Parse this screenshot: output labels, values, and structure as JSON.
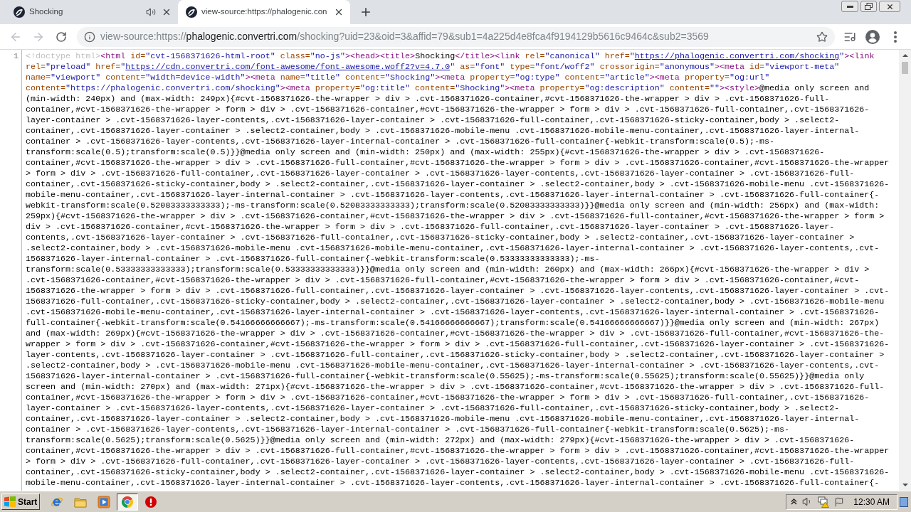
{
  "tabs": [
    {
      "title": "Shocking",
      "selected": false,
      "audio": true
    },
    {
      "title": "view-source:https://phalogenic.con",
      "selected": true,
      "audio": false
    }
  ],
  "toolbar": {
    "back": {
      "disabled": true
    },
    "forward": {
      "disabled": true
    }
  },
  "address_bar": {
    "url_parts": [
      {
        "text": "view-source:https://",
        "emphasis": false
      },
      {
        "text": "phalogenic.convertri.com",
        "emphasis": true
      },
      {
        "text": "/shocking?uid=23&oid=3&affid=79&sub1=4a225d4e8fca4f9194129b5616c9464c&sub2=3569",
        "emphasis": false
      }
    ]
  },
  "source": {
    "line_number": "1",
    "rows": [
      {
        "segments": [
          {
            "kind": "doctype",
            "text": "<!doctype html>"
          },
          {
            "kind": "tag",
            "text": "<html"
          },
          {
            "kind": "attr",
            "text": " id="
          },
          {
            "kind": "value",
            "text": "\"cvt-1568371626-html-root\""
          },
          {
            "kind": "attr",
            "text": " class="
          },
          {
            "kind": "value",
            "text": "\"no-js\""
          },
          {
            "kind": "tag",
            "text": "><head><title>"
          },
          {
            "kind": "text",
            "text": "Shocking"
          },
          {
            "kind": "tag",
            "text": "</title><link"
          },
          {
            "kind": "attr",
            "text": " rel="
          },
          {
            "kind": "value",
            "text": "\"canonical\""
          },
          {
            "kind": "attr",
            "text": " href="
          },
          {
            "kind": "value",
            "text": "\""
          },
          {
            "kind": "link",
            "text": "https://phalogenic.convertri.com/shocking"
          },
          {
            "kind": "value",
            "text": "\""
          },
          {
            "kind": "tag",
            "text": "><link"
          }
        ]
      },
      {
        "segments": [
          {
            "kind": "attr",
            "text": "rel="
          },
          {
            "kind": "value",
            "text": "\"preload\""
          },
          {
            "kind": "attr",
            "text": " href="
          },
          {
            "kind": "value",
            "text": "\""
          },
          {
            "kind": "link",
            "text": "https://cdn.convertri.com/font-awesome/font-awesome.woff2?v=4.7.0"
          },
          {
            "kind": "value",
            "text": "\""
          },
          {
            "kind": "attr",
            "text": " as="
          },
          {
            "kind": "value",
            "text": "\"font\""
          },
          {
            "kind": "attr",
            "text": " type="
          },
          {
            "kind": "value",
            "text": "\"font/woff2\""
          },
          {
            "kind": "attr",
            "text": " crossorigin="
          },
          {
            "kind": "value",
            "text": "\"anonymous\""
          },
          {
            "kind": "tag",
            "text": "><meta"
          },
          {
            "kind": "attr",
            "text": " id="
          },
          {
            "kind": "value",
            "text": "\"viewport-meta\""
          }
        ]
      },
      {
        "segments": [
          {
            "kind": "attr",
            "text": "name="
          },
          {
            "kind": "value",
            "text": "\"viewport\""
          },
          {
            "kind": "attr",
            "text": " content="
          },
          {
            "kind": "value",
            "text": "\"width=device-width\""
          },
          {
            "kind": "tag",
            "text": "><meta"
          },
          {
            "kind": "attr",
            "text": " name="
          },
          {
            "kind": "value",
            "text": "\"title\""
          },
          {
            "kind": "attr",
            "text": " content="
          },
          {
            "kind": "value",
            "text": "\"Shocking\""
          },
          {
            "kind": "tag",
            "text": "><meta"
          },
          {
            "kind": "attr",
            "text": " property="
          },
          {
            "kind": "value",
            "text": "\"og:type\""
          },
          {
            "kind": "attr",
            "text": " content="
          },
          {
            "kind": "value",
            "text": "\"article\""
          },
          {
            "kind": "tag",
            "text": "><meta"
          },
          {
            "kind": "attr",
            "text": " property="
          },
          {
            "kind": "value",
            "text": "\"og:url\""
          }
        ]
      },
      {
        "segments": [
          {
            "kind": "attr",
            "text": "content="
          },
          {
            "kind": "value",
            "text": "\"https://phalogenic.convertri.com/shocking\""
          },
          {
            "kind": "tag",
            "text": "><meta"
          },
          {
            "kind": "attr",
            "text": " property="
          },
          {
            "kind": "value",
            "text": "\"og:title\""
          },
          {
            "kind": "attr",
            "text": " content="
          },
          {
            "kind": "value",
            "text": "\"Shocking\""
          },
          {
            "kind": "tag",
            "text": "><meta"
          },
          {
            "kind": "attr",
            "text": " property="
          },
          {
            "kind": "value",
            "text": "\"og:description\""
          },
          {
            "kind": "attr",
            "text": " content="
          },
          {
            "kind": "value",
            "text": "\"\""
          },
          {
            "kind": "tag",
            "text": "><style>"
          },
          {
            "kind": "text",
            "text": "@media only screen and"
          }
        ]
      },
      {
        "segments": [
          {
            "kind": "text",
            "text": "(min-width: 240px) and (max-width: 249px){#cvt-1568371626-the-wrapper > div > .cvt-1568371626-container,#cvt-1568371626-the-wrapper > div > .cvt-1568371626-full-"
          }
        ]
      },
      {
        "segments": [
          {
            "kind": "text",
            "text": "container,#cvt-1568371626-the-wrapper > form > div > .cvt-1568371626-container,#cvt-1568371626-the-wrapper > form > div > .cvt-1568371626-full-container,.cvt-1568371626-"
          }
        ]
      },
      {
        "segments": [
          {
            "kind": "text",
            "text": "layer-container > .cvt-1568371626-layer-contents,.cvt-1568371626-layer-container > .cvt-1568371626-full-container,.cvt-1568371626-sticky-container,body > .select2-"
          }
        ]
      },
      {
        "segments": [
          {
            "kind": "text",
            "text": "container,.cvt-1568371626-layer-container > .select2-container,body > .cvt-1568371626-mobile-menu .cvt-1568371626-mobile-menu-container,.cvt-1568371626-layer-internal-"
          }
        ]
      },
      {
        "segments": [
          {
            "kind": "text",
            "text": "container > .cvt-1568371626-layer-contents,.cvt-1568371626-layer-internal-container > .cvt-1568371626-full-container{-webkit-transform:scale(0.5);-ms-"
          }
        ]
      },
      {
        "segments": [
          {
            "kind": "text",
            "text": "transform:scale(0.5);transform:scale(0.5)}}@media only screen and (min-width: 250px) and (max-width: 255px){#cvt-1568371626-the-wrapper > div > .cvt-1568371626-"
          }
        ]
      },
      {
        "segments": [
          {
            "kind": "text",
            "text": "container,#cvt-1568371626-the-wrapper > div > .cvt-1568371626-full-container,#cvt-1568371626-the-wrapper > form > div > .cvt-1568371626-container,#cvt-1568371626-the-wrapper"
          }
        ]
      },
      {
        "segments": [
          {
            "kind": "text",
            "text": "> form > div > .cvt-1568371626-full-container,.cvt-1568371626-layer-container > .cvt-1568371626-layer-contents,.cvt-1568371626-layer-container > .cvt-1568371626-full-"
          }
        ]
      },
      {
        "segments": [
          {
            "kind": "text",
            "text": "container,.cvt-1568371626-sticky-container,body > .select2-container,.cvt-1568371626-layer-container > .select2-container,body > .cvt-1568371626-mobile-menu .cvt-1568371626-"
          }
        ]
      },
      {
        "segments": [
          {
            "kind": "text",
            "text": "mobile-menu-container,.cvt-1568371626-layer-internal-container > .cvt-1568371626-layer-contents,.cvt-1568371626-layer-internal-container > .cvt-1568371626-full-container{-"
          }
        ]
      },
      {
        "segments": [
          {
            "kind": "text",
            "text": "webkit-transform:scale(0.52083333333333);-ms-transform:scale(0.52083333333333);transform:scale(0.52083333333333)}}@media only screen and (min-width: 256px) and (max-width:"
          }
        ]
      },
      {
        "segments": [
          {
            "kind": "text",
            "text": "259px){#cvt-1568371626-the-wrapper > div > .cvt-1568371626-container,#cvt-1568371626-the-wrapper > div > .cvt-1568371626-full-container,#cvt-1568371626-the-wrapper > form >"
          }
        ]
      },
      {
        "segments": [
          {
            "kind": "text",
            "text": "div > .cvt-1568371626-container,#cvt-1568371626-the-wrapper > form > div > .cvt-1568371626-full-container,.cvt-1568371626-layer-container > .cvt-1568371626-layer-"
          }
        ]
      },
      {
        "segments": [
          {
            "kind": "text",
            "text": "contents,.cvt-1568371626-layer-container > .cvt-1568371626-full-container,.cvt-1568371626-sticky-container,body > .select2-container,.cvt-1568371626-layer-container >"
          }
        ]
      },
      {
        "segments": [
          {
            "kind": "text",
            "text": ".select2-container,body > .cvt-1568371626-mobile-menu .cvt-1568371626-mobile-menu-container,.cvt-1568371626-layer-internal-container > .cvt-1568371626-layer-contents,.cvt-"
          }
        ]
      },
      {
        "segments": [
          {
            "kind": "text",
            "text": "1568371626-layer-internal-container > .cvt-1568371626-full-container{-webkit-transform:scale(0.53333333333333);-ms-"
          }
        ]
      },
      {
        "segments": [
          {
            "kind": "text",
            "text": "transform:scale(0.53333333333333);transform:scale(0.53333333333333)}}@media only screen and (min-width: 260px) and (max-width: 266px){#cvt-1568371626-the-wrapper > div >"
          }
        ]
      },
      {
        "segments": [
          {
            "kind": "text",
            "text": ".cvt-1568371626-container,#cvt-1568371626-the-wrapper > div > .cvt-1568371626-full-container,#cvt-1568371626-the-wrapper > form > div > .cvt-1568371626-container,#cvt-"
          }
        ]
      },
      {
        "segments": [
          {
            "kind": "text",
            "text": "1568371626-the-wrapper > form > div > .cvt-1568371626-full-container,.cvt-1568371626-layer-container > .cvt-1568371626-layer-contents,.cvt-1568371626-layer-container > .cvt-"
          }
        ]
      },
      {
        "segments": [
          {
            "kind": "text",
            "text": "1568371626-full-container,.cvt-1568371626-sticky-container,body > .select2-container,.cvt-1568371626-layer-container > .select2-container,body > .cvt-1568371626-mobile-menu"
          }
        ]
      },
      {
        "segments": [
          {
            "kind": "text",
            "text": ".cvt-1568371626-mobile-menu-container,.cvt-1568371626-layer-internal-container > .cvt-1568371626-layer-contents,.cvt-1568371626-layer-internal-container > .cvt-1568371626-"
          }
        ]
      },
      {
        "segments": [
          {
            "kind": "text",
            "text": "full-container{-webkit-transform:scale(0.54166666666667);-ms-transform:scale(0.54166666666667);transform:scale(0.54166666666667)}}@media only screen and (min-width: 267px)"
          }
        ]
      },
      {
        "segments": [
          {
            "kind": "text",
            "text": "and (max-width: 269px){#cvt-1568371626-the-wrapper > div > .cvt-1568371626-container,#cvt-1568371626-the-wrapper > div > .cvt-1568371626-full-container,#cvt-1568371626-the-"
          }
        ]
      },
      {
        "segments": [
          {
            "kind": "text",
            "text": "wrapper > form > div > .cvt-1568371626-container,#cvt-1568371626-the-wrapper > form > div > .cvt-1568371626-full-container,.cvt-1568371626-layer-container > .cvt-1568371626-"
          }
        ]
      },
      {
        "segments": [
          {
            "kind": "text",
            "text": "layer-contents,.cvt-1568371626-layer-container > .cvt-1568371626-full-container,.cvt-1568371626-sticky-container,body > .select2-container,.cvt-1568371626-layer-container >"
          }
        ]
      },
      {
        "segments": [
          {
            "kind": "text",
            "text": ".select2-container,body > .cvt-1568371626-mobile-menu .cvt-1568371626-mobile-menu-container,.cvt-1568371626-layer-internal-container > .cvt-1568371626-layer-contents,.cvt-"
          }
        ]
      },
      {
        "segments": [
          {
            "kind": "text",
            "text": "1568371626-layer-internal-container > .cvt-1568371626-full-container{-webkit-transform:scale(0.55625);-ms-transform:scale(0.55625);transform:scale(0.55625)}}@media only"
          }
        ]
      },
      {
        "segments": [
          {
            "kind": "text",
            "text": "screen and (min-width: 270px) and (max-width: 271px){#cvt-1568371626-the-wrapper > div > .cvt-1568371626-container,#cvt-1568371626-the-wrapper > div > .cvt-1568371626-full-"
          }
        ]
      },
      {
        "segments": [
          {
            "kind": "text",
            "text": "container,#cvt-1568371626-the-wrapper > form > div > .cvt-1568371626-container,#cvt-1568371626-the-wrapper > form > div > .cvt-1568371626-full-container,.cvt-1568371626-"
          }
        ]
      },
      {
        "segments": [
          {
            "kind": "text",
            "text": "layer-container > .cvt-1568371626-layer-contents,.cvt-1568371626-layer-container > .cvt-1568371626-full-container,.cvt-1568371626-sticky-container,body > .select2-"
          }
        ]
      },
      {
        "segments": [
          {
            "kind": "text",
            "text": "container,.cvt-1568371626-layer-container > .select2-container,body > .cvt-1568371626-mobile-menu .cvt-1568371626-mobile-menu-container,.cvt-1568371626-layer-internal-"
          }
        ]
      },
      {
        "segments": [
          {
            "kind": "text",
            "text": "container > .cvt-1568371626-layer-contents,.cvt-1568371626-layer-internal-container > .cvt-1568371626-full-container{-webkit-transform:scale(0.5625);-ms-"
          }
        ]
      },
      {
        "segments": [
          {
            "kind": "text",
            "text": "transform:scale(0.5625);transform:scale(0.5625)}}@media only screen and (min-width: 272px) and (max-width: 279px){#cvt-1568371626-the-wrapper > div > .cvt-1568371626-"
          }
        ]
      },
      {
        "segments": [
          {
            "kind": "text",
            "text": "container,#cvt-1568371626-the-wrapper > div > .cvt-1568371626-full-container,#cvt-1568371626-the-wrapper > form > div > .cvt-1568371626-container,#cvt-1568371626-the-wrapper"
          }
        ]
      },
      {
        "segments": [
          {
            "kind": "text",
            "text": "> form > div > .cvt-1568371626-full-container,.cvt-1568371626-layer-container > .cvt-1568371626-layer-contents,.cvt-1568371626-layer-container > .cvt-1568371626-full-"
          }
        ]
      },
      {
        "segments": [
          {
            "kind": "text",
            "text": "container,.cvt-1568371626-sticky-container,body > .select2-container,.cvt-1568371626-layer-container > .select2-container,body > .cvt-1568371626-mobile-menu .cvt-1568371626-"
          }
        ]
      },
      {
        "segments": [
          {
            "kind": "text",
            "text": "mobile-menu-container,.cvt-1568371626-layer-internal-container > .cvt-1568371626-layer-contents,.cvt-1568371626-layer-internal-container > .cvt-1568371626-full-container{-"
          }
        ]
      }
    ]
  },
  "taskbar": {
    "start": "Start",
    "apps": [
      {
        "selected": false
      },
      {
        "selected": false
      },
      {
        "selected": false
      },
      {
        "selected": true
      },
      {
        "selected": false
      }
    ],
    "clock": "12:30 AM"
  }
}
